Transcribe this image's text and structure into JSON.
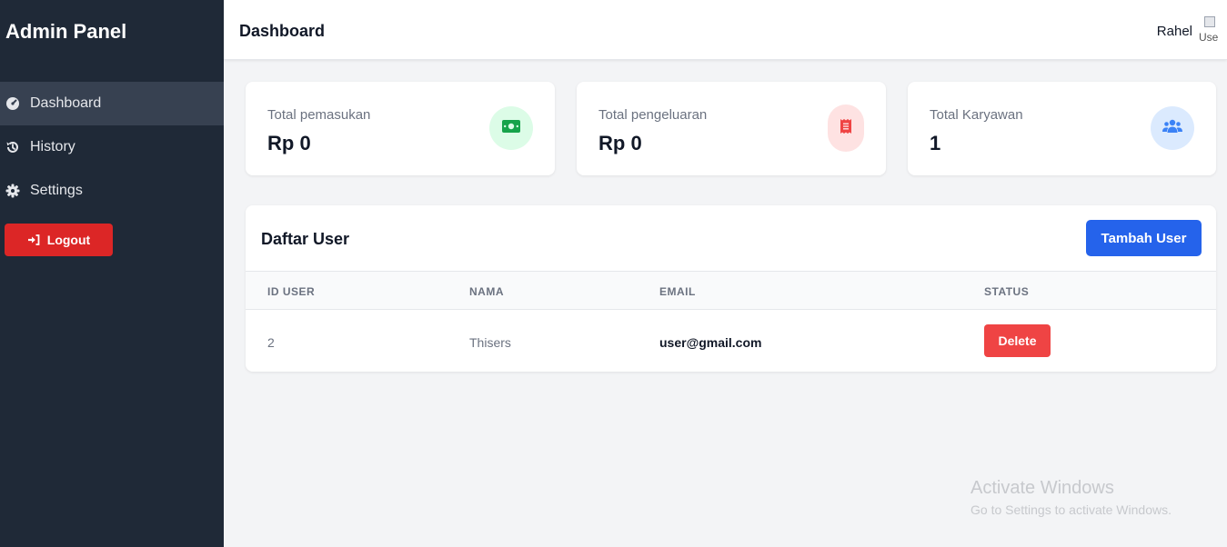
{
  "sidebar": {
    "brand": "Admin Panel",
    "items": [
      {
        "label": "Dashboard",
        "icon": "dashboard-icon",
        "active": true
      },
      {
        "label": "History",
        "icon": "history-icon",
        "active": false
      },
      {
        "label": "Settings",
        "icon": "gear-icon",
        "active": false
      }
    ],
    "logout_label": "Logout"
  },
  "header": {
    "title": "Dashboard",
    "user_name": "Rahel",
    "avatar_alt": "Use"
  },
  "stats": [
    {
      "label": "Total pemasukan",
      "value": "Rp 0",
      "icon": "money-icon",
      "badge_bg": "#dcfce7",
      "icon_color": "#16a34a"
    },
    {
      "label": "Total pengeluaran",
      "value": "Rp 0",
      "icon": "receipt-icon",
      "badge_bg": "#fee2e2",
      "icon_color": "#ef4444"
    },
    {
      "label": "Total Karyawan",
      "value": "1",
      "icon": "users-icon",
      "badge_bg": "#dbeafe",
      "icon_color": "#3b82f6"
    }
  ],
  "users_panel": {
    "title": "Daftar User",
    "add_button": "Tambah User",
    "columns": [
      "ID USER",
      "NAMA",
      "EMAIL",
      "STATUS"
    ],
    "rows": [
      {
        "id": "2",
        "name": "Thisers",
        "email": "user@gmail.com",
        "action": "Delete"
      }
    ]
  },
  "watermark": {
    "line1": "Activate Windows",
    "line2": "Go to Settings to activate Windows."
  },
  "colors": {
    "sidebar_bg": "#1f2937",
    "active_item_bg": "#374151",
    "logout": "#dc2626",
    "primary": "#2563eb",
    "danger": "#ef4444"
  }
}
